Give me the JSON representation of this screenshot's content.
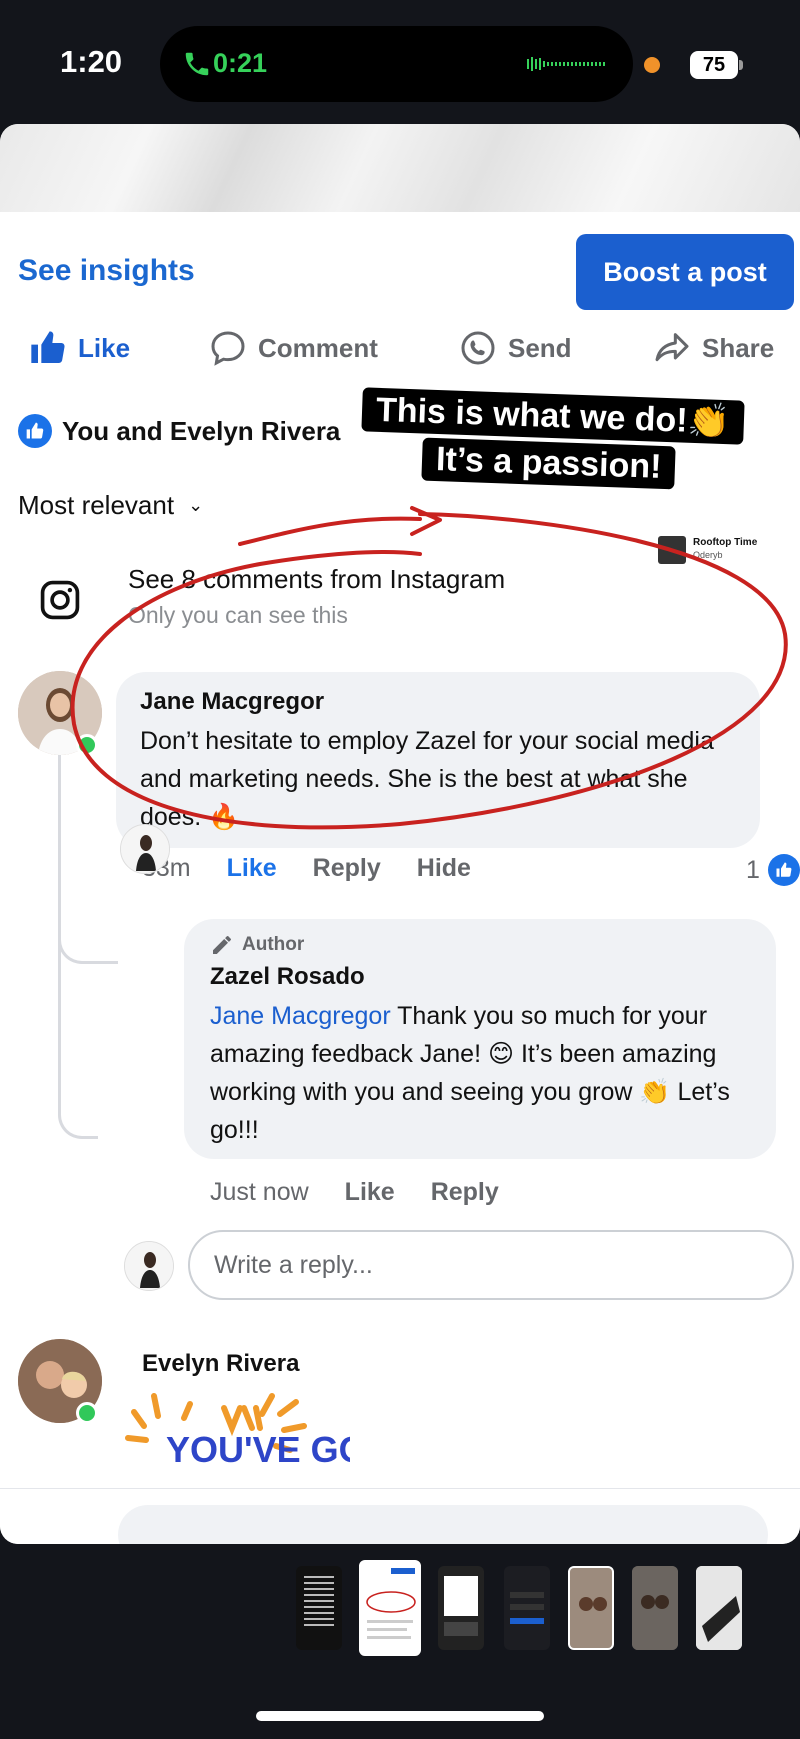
{
  "status_bar": {
    "time": "1:20",
    "call_timer": "0:21",
    "battery": "75"
  },
  "page": {
    "see_insights": "See insights",
    "boost_post": "Boost a post",
    "actions": {
      "like": "Like",
      "comment": "Comment",
      "send": "Send",
      "share": "Share"
    },
    "reactions_text": "You and Evelyn Rivera",
    "overlay": {
      "line1": "This is what we do!👏",
      "line2": "It’s a passion!"
    },
    "sort_label": "Most relevant",
    "music": {
      "title": "Rooftop Time",
      "artist": "Oderyb"
    },
    "instagram": {
      "title": "See 8 comments from Instagram",
      "subtitle": "Only you can see this"
    }
  },
  "comments": [
    {
      "name": "Jane Macgregor",
      "text": "Don’t hesitate to employ Zazel for your social media and marketing needs. She is the best at what she does. 🔥",
      "time": "33m",
      "like": "Like",
      "reply": "Reply",
      "hide": "Hide",
      "like_count": "1"
    },
    {
      "tag": "Author",
      "name": "Zazel Rosado",
      "mention": "Jane Macgregor",
      "text": " Thank you so much for your amazing feedback Jane! 😊 It’s been amazing working with you and seeing you grow 👏 Let’s go!!!",
      "time": "Just now",
      "like": "Like",
      "reply": "Reply"
    },
    {
      "name": "Evelyn Rivera",
      "sticker_text": "YOU'VE GOT"
    }
  ],
  "reply_input": {
    "placeholder": "Write a reply..."
  },
  "colors": {
    "accent": "#1b5fcf",
    "annotation": "#c8221f",
    "online": "#31c85a"
  }
}
